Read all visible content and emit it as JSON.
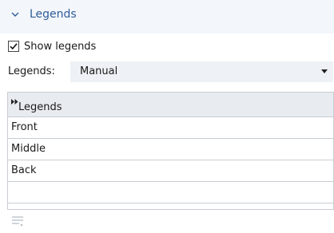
{
  "section": {
    "title": "Legends",
    "collapse_icon": "chevron-down-icon"
  },
  "show_legends": {
    "label": "Show legends",
    "checked": true
  },
  "legends_select": {
    "label": "Legends:",
    "value": "Manual"
  },
  "table": {
    "column_header": "Legends",
    "header_icon": "fast-forward-icon",
    "rows": [
      "Front",
      "Middle",
      "Back",
      ""
    ]
  },
  "footer_icon": "list-settings-icon",
  "colors": {
    "accent": "#2f5d9a",
    "header_bg": "#f3f6fa",
    "table_header_bg": "#e8ecf1"
  }
}
